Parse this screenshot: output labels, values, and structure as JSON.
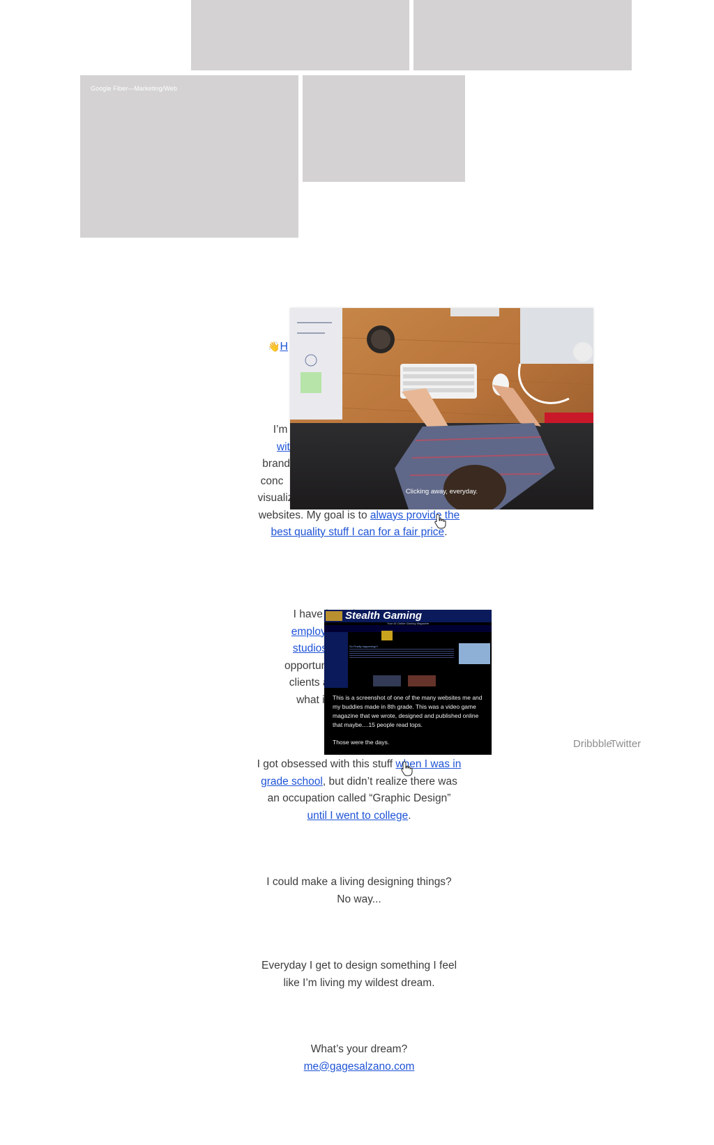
{
  "portfolio": {
    "tiles": [
      {
        "caption": ""
      },
      {
        "caption": ""
      },
      {
        "caption": "Google Fiber—Marketing/Web"
      },
      {
        "caption": ""
      }
    ]
  },
  "greeting": {
    "emoji": "👋",
    "link_fragment": "H"
  },
  "intro": {
    "line1_pre": "I’m a ",
    "line1_link": "g",
    "line2_link": "with t",
    "line3": "brands",
    "line4": "conc",
    "line5": "visualiz",
    "line6_pre": "websites. My goal is to ",
    "line6_link": "always provide the",
    "line7_link": "best quality stuff I can for a fair price",
    "line7_post": "."
  },
  "desk_popup": {
    "caption": "Clicking away, everyday."
  },
  "employment": {
    "line1": "I have been l",
    "line2_link": "employed at",
    "line3_link": "studios thro",
    "line4": "opportunity to",
    "line5": "clients and le",
    "line6": "what it tak"
  },
  "stealth_popup": {
    "site_title": "Stealth Gaming",
    "site_tagline": "Your #1 Online Gaming Magazine",
    "headline": "So Finally happening!!!",
    "caption": "This is a screenshot of one of the many websites me and my buddies made in 8th grade. This was a video game magazine that we wrote, designed and published online that maybe....15 people read tops.",
    "caption2": "Those were the days."
  },
  "school": {
    "line1_pre": "I got obsessed with this stuff ",
    "line1_link": "when I was in",
    "line2_link": "grade school",
    "line2_post": ", but didn’t realize there was",
    "line3": "an occupation called “Graphic Design”",
    "line4_link": "until I went to college",
    "line4_post": "."
  },
  "living": {
    "line1": "I could make a living designing things?",
    "line2": "No way..."
  },
  "dream": {
    "line1": "Everyday I get to design something I feel",
    "line2": "like I’m living my wildest dream."
  },
  "contact": {
    "question": "What’s your dream?",
    "email": "me@gagesalzano.com"
  },
  "social": {
    "dribbble": "Dribbble",
    "twitter": "Twitter"
  },
  "colors": {
    "link": "#1e53d6",
    "tile": "#d4d2d3",
    "text": "#3c3c3c"
  },
  "icons": [
    "waving-hand-icon",
    "hand-pointer-icon"
  ]
}
